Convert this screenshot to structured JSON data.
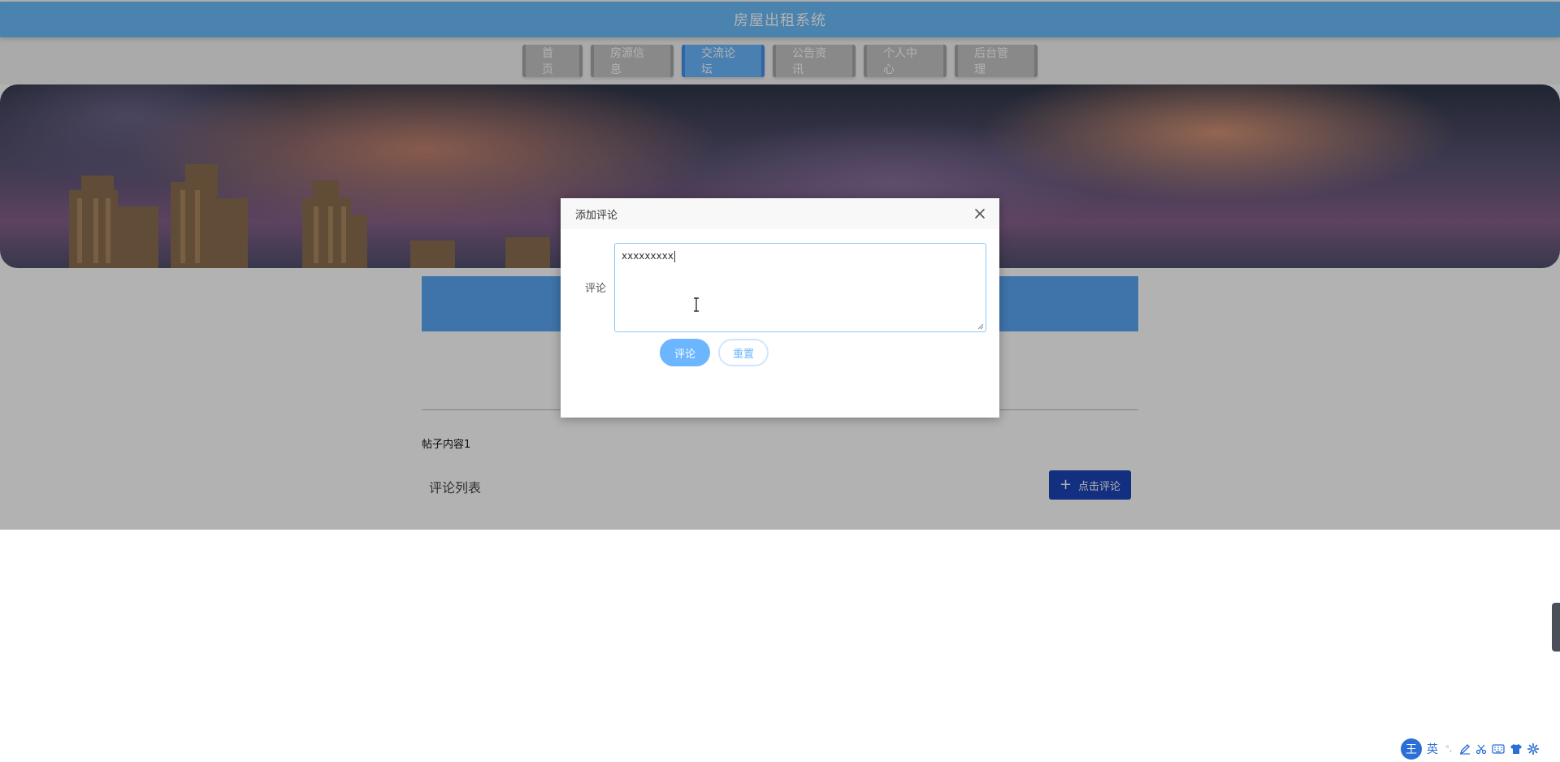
{
  "app": {
    "title": "房屋出租系统"
  },
  "nav": {
    "items": [
      {
        "label": "首页",
        "active": false
      },
      {
        "label": "房源信息",
        "active": false
      },
      {
        "label": "交流论坛",
        "active": true
      },
      {
        "label": "公告资讯",
        "active": false
      },
      {
        "label": "个人中心",
        "active": false
      },
      {
        "label": "后台管理",
        "active": false
      }
    ]
  },
  "post": {
    "content": "帖子内容1",
    "comments_title": "评论列表",
    "comment_button": "点击评论",
    "comment_button_icon": "plus-icon"
  },
  "dialog": {
    "title": "添加评论",
    "field_label": "评论",
    "textarea_value": "xxxxxxxxx",
    "submit_label": "评论",
    "reset_label": "重置",
    "close_icon": "close-icon"
  },
  "ime": {
    "logo": "王",
    "mode": "英",
    "punct": "°,",
    "icons": [
      "pen-icon",
      "scissors-icon",
      "keyboard-icon",
      "shirt-icon",
      "gear-icon"
    ]
  },
  "colors": {
    "header": "#6bbcf9",
    "nav_active": "#6bb6ff",
    "nav_inactive": "#c4c4c4",
    "primary_button": "#1c44b8"
  }
}
